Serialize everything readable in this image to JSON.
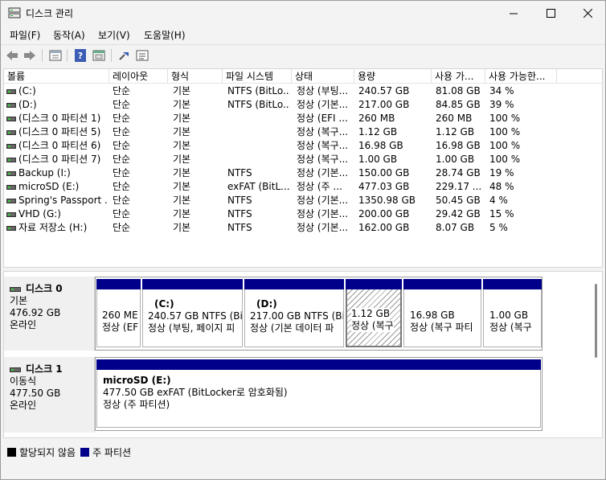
{
  "window": {
    "title": "디스크 관리"
  },
  "menu": [
    "파일(F)",
    "동작(A)",
    "보기(V)",
    "도움말(H)"
  ],
  "toolbar": [
    "back-icon",
    "forward-icon",
    "properties-icon",
    "help-icon",
    "console-icon",
    "connect-icon",
    "view-icon"
  ],
  "columns": [
    "볼륨",
    "레이아웃",
    "형식",
    "파일 시스템",
    "상태",
    "용량",
    "사용 가...",
    "사용 가능한..."
  ],
  "volumes": [
    {
      "name": "(C:)",
      "layout": "단순",
      "type": "기본",
      "fs": "NTFS (BitLo...",
      "status": "정상 (부팅...",
      "capacity": "240.57 GB",
      "free": "81.08 GB",
      "pct": "34 %"
    },
    {
      "name": "(D:)",
      "layout": "단순",
      "type": "기본",
      "fs": "NTFS (BitLo...",
      "status": "정상 (기본...",
      "capacity": "217.00 GB",
      "free": "84.85 GB",
      "pct": "39 %"
    },
    {
      "name": "(디스크 0 파티션 1)",
      "layout": "단순",
      "type": "기본",
      "fs": "",
      "status": "정상 (EFI ...",
      "capacity": "260 MB",
      "free": "260 MB",
      "pct": "100 %"
    },
    {
      "name": "(디스크 0 파티션 5)",
      "layout": "단순",
      "type": "기본",
      "fs": "",
      "status": "정상 (복구...",
      "capacity": "1.12 GB",
      "free": "1.12 GB",
      "pct": "100 %"
    },
    {
      "name": "(디스크 0 파티션 6)",
      "layout": "단순",
      "type": "기본",
      "fs": "",
      "status": "정상 (복구...",
      "capacity": "16.98 GB",
      "free": "16.98 GB",
      "pct": "100 %"
    },
    {
      "name": "(디스크 0 파티션 7)",
      "layout": "단순",
      "type": "기본",
      "fs": "",
      "status": "정상 (복구...",
      "capacity": "1.00 GB",
      "free": "1.00 GB",
      "pct": "100 %"
    },
    {
      "name": "Backup (I:)",
      "layout": "단순",
      "type": "기본",
      "fs": "NTFS",
      "status": "정상 (기본...",
      "capacity": "150.00 GB",
      "free": "28.74 GB",
      "pct": "19 %"
    },
    {
      "name": "microSD (E:)",
      "layout": "단순",
      "type": "기본",
      "fs": "exFAT (BitL...",
      "status": "정상 (주 ...",
      "capacity": "477.03 GB",
      "free": "229.17 ...",
      "pct": "48 %"
    },
    {
      "name": "Spring's Passport ...",
      "layout": "단순",
      "type": "기본",
      "fs": "NTFS",
      "status": "정상 (기본...",
      "capacity": "1350.98 GB",
      "free": "50.45 GB",
      "pct": "4 %"
    },
    {
      "name": "VHD (G:)",
      "layout": "단순",
      "type": "기본",
      "fs": "NTFS",
      "status": "정상 (기본...",
      "capacity": "200.00 GB",
      "free": "29.42 GB",
      "pct": "15 %"
    },
    {
      "name": "자료 저장소 (H:)",
      "layout": "단순",
      "type": "기본",
      "fs": "NTFS",
      "status": "정상 (기본...",
      "capacity": "162.00 GB",
      "free": "8.07 GB",
      "pct": "5 %"
    }
  ],
  "disks": [
    {
      "name": "디스크 0",
      "kind": "기본",
      "size": "476.92 GB",
      "state": "온라인",
      "partitions": [
        {
          "title": "",
          "l1": "260 ME",
          "l2": "정상 (EF"
        },
        {
          "title": "(C:)",
          "l1": "240.57 GB NTFS (Bit",
          "l2": "정상 (부팅, 페이지 피"
        },
        {
          "title": "(D:)",
          "l1": "217.00 GB NTFS (Bit",
          "l2": "정상 (기본 데이터 파"
        },
        {
          "title": "",
          "l1": "1.12 GB",
          "l2": "정상 (복구"
        },
        {
          "title": "",
          "l1": "16.98 GB",
          "l2": "정상 (복구 파티"
        },
        {
          "title": "",
          "l1": "1.00 GB",
          "l2": "정상 (복구"
        }
      ]
    },
    {
      "name": "디스크 1",
      "kind": "이동식",
      "size": "477.50 GB",
      "state": "온라인",
      "partitions": [
        {
          "title": "microSD  (E:)",
          "l1": "477.50 GB exFAT (BitLocker로 암호화됨)",
          "l2": "정상 (주 파티션)"
        }
      ]
    }
  ],
  "legend": [
    {
      "label": "할당되지 않음",
      "color": "#000000"
    },
    {
      "label": "주 파티션",
      "color": "#00008b"
    }
  ],
  "colors": {
    "primary_partition": "#00008b",
    "unallocated": "#000000"
  }
}
